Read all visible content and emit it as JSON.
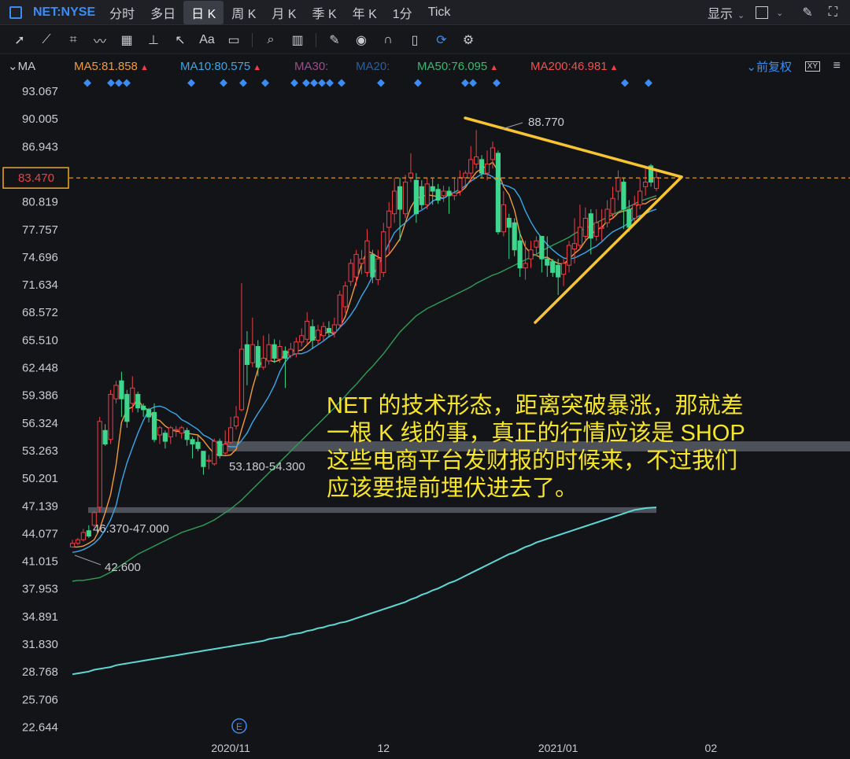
{
  "topbar": {
    "symbol": "NET:NYSE",
    "periods": [
      "分时",
      "多日",
      "日 K",
      "周 K",
      "月 K",
      "季 K",
      "年 K",
      "1分",
      "Tick"
    ],
    "active_period_index": 2,
    "show_label": "显示"
  },
  "toolbar": {
    "tools": [
      "cursor-icon",
      "trendline-icon",
      "polyline-icon",
      "wave-icon",
      "fibonacci-icon",
      "horizontal-line-icon",
      "arrow-icon",
      "text-icon",
      "note-icon",
      "zoom-icon",
      "measure-icon",
      "pen-icon",
      "eye-icon",
      "magnet-icon",
      "trash-icon",
      "sync-icon",
      "settings-icon"
    ],
    "text_tool_label": "Aa"
  },
  "indicators": {
    "label": "MA",
    "ma5": "MA5:81.858",
    "ma10": "MA10:80.575",
    "ma30": "MA30:",
    "ma20": "MA20:",
    "ma50": "MA50:76.095",
    "ma200": "MA200:46.981",
    "adjust_label": "前复权",
    "colors": {
      "ma5": "#f29a3c",
      "ma10": "#3aa7e8",
      "ma30": "#9a4f8d",
      "ma20": "#2d5f99",
      "ma50": "#3ab86e",
      "ma200": "#f05050"
    }
  },
  "chart_data": {
    "type": "candlestick",
    "symbol": "NET:NYSE",
    "y_ticks": [
      "93.067",
      "90.005",
      "86.943",
      "83.881",
      "80.819",
      "77.757",
      "74.696",
      "71.634",
      "68.572",
      "65.510",
      "62.448",
      "59.386",
      "56.324",
      "53.263",
      "50.201",
      "47.139",
      "44.077",
      "41.015",
      "37.953",
      "34.891",
      "31.830",
      "28.768",
      "25.706",
      "22.644"
    ],
    "ylim": [
      22.644,
      93.067
    ],
    "x_ticks": [
      "2020/11",
      "12",
      "2021/01",
      "02"
    ],
    "current_price": "83.470",
    "current_price_value": 83.47,
    "candles": [
      [
        42.6,
        43.0,
        42.6,
        43.4
      ],
      [
        43.0,
        43.4,
        42.8,
        43.6
      ],
      [
        43.4,
        44.2,
        43.2,
        44.6
      ],
      [
        44.4,
        43.8,
        43.6,
        45.0
      ],
      [
        45.0,
        46.4,
        44.8,
        46.6
      ],
      [
        47.0,
        56.5,
        46.4,
        57.0
      ],
      [
        55.5,
        54.0,
        53.8,
        56.2
      ],
      [
        54.5,
        59.5,
        54.0,
        60.0
      ],
      [
        59.0,
        60.5,
        58.5,
        61.0
      ],
      [
        61.0,
        59.0,
        57.0,
        62.0
      ],
      [
        59.5,
        56.5,
        55.8,
        60.0
      ],
      [
        58.5,
        60.2,
        57.5,
        61.5
      ],
      [
        59.5,
        58.0,
        57.5,
        59.8
      ],
      [
        58.2,
        57.8,
        57.0,
        58.5
      ],
      [
        57.8,
        57.0,
        56.4,
        58.0
      ],
      [
        57.5,
        54.5,
        54.2,
        58.5
      ],
      [
        55.0,
        55.8,
        54.0,
        56.0
      ],
      [
        55.2,
        54.3,
        53.5,
        55.5
      ],
      [
        54.8,
        55.8,
        54.0,
        56.0
      ],
      [
        55.6,
        55.6,
        54.8,
        56.0
      ],
      [
        55.2,
        55.8,
        54.6,
        56.0
      ],
      [
        55.5,
        54.5,
        53.8,
        55.8
      ],
      [
        54.5,
        54.0,
        52.4,
        54.8
      ],
      [
        54.2,
        53.5,
        53.2,
        55.0
      ],
      [
        53.2,
        51.5,
        50.6,
        53.2
      ],
      [
        52.2,
        52.2,
        51.2,
        52.8
      ],
      [
        51.8,
        54.3,
        51.6,
        54.6
      ],
      [
        54.3,
        52.7,
        52.4,
        54.6
      ],
      [
        53.0,
        54.0,
        52.8,
        55.5
      ],
      [
        54.2,
        55.8,
        54.0,
        57.0
      ],
      [
        56.0,
        57.0,
        55.6,
        58.2
      ],
      [
        57.8,
        64.5,
        57.6,
        71.8
      ],
      [
        65.0,
        62.8,
        60.5,
        66.5
      ],
      [
        63.0,
        65.0,
        62.5,
        68.0
      ],
      [
        64.8,
        62.5,
        61.5,
        65.5
      ],
      [
        62.5,
        63.5,
        62.2,
        66.0
      ],
      [
        63.2,
        65.0,
        62.8,
        66.2
      ],
      [
        65.0,
        63.5,
        63.0,
        65.6
      ],
      [
        63.4,
        64.8,
        63.0,
        65.5
      ],
      [
        64.3,
        63.5,
        60.2,
        64.8
      ],
      [
        63.8,
        64.5,
        63.5,
        65.2
      ],
      [
        64.0,
        65.3,
        63.6,
        65.8
      ],
      [
        65.3,
        66.0,
        64.8,
        66.8
      ],
      [
        65.6,
        67.6,
        65.0,
        68.6
      ],
      [
        67.0,
        65.5,
        64.5,
        67.8
      ],
      [
        65.5,
        66.6,
        65.0,
        67.2
      ],
      [
        66.0,
        67.0,
        65.4,
        67.5
      ],
      [
        66.8,
        66.4,
        65.8,
        67.6
      ],
      [
        66.4,
        67.2,
        65.8,
        68.0
      ],
      [
        67.2,
        70.5,
        66.8,
        71.0
      ],
      [
        69.2,
        71.5,
        68.5,
        72.0
      ],
      [
        72.0,
        74.0,
        71.5,
        74.5
      ],
      [
        72.5,
        75.0,
        71.5,
        75.5
      ],
      [
        74.0,
        74.5,
        72.8,
        75.5
      ],
      [
        73.0,
        76.5,
        72.5,
        77.8
      ],
      [
        75.0,
        72.5,
        71.8,
        75.5
      ],
      [
        72.2,
        74.5,
        71.6,
        75.5
      ],
      [
        73.0,
        77.5,
        72.5,
        78.5
      ],
      [
        78.0,
        79.8,
        75.0,
        80.8
      ],
      [
        79.5,
        82.0,
        78.5,
        83.5
      ],
      [
        82.5,
        80.0,
        76.5,
        83.5
      ],
      [
        79.5,
        83.0,
        79.0,
        83.8
      ],
      [
        83.5,
        84.0,
        83.0,
        86.2
      ],
      [
        83.2,
        79.5,
        78.5,
        84.0
      ],
      [
        82.5,
        80.5,
        80.0,
        83.2
      ],
      [
        80.5,
        82.8,
        80.0,
        83.5
      ],
      [
        82.5,
        82.0,
        80.5,
        83.4
      ],
      [
        82.2,
        81.0,
        80.6,
        82.8
      ],
      [
        81.5,
        82.0,
        80.8,
        82.6
      ],
      [
        82.0,
        81.5,
        79.5,
        82.5
      ],
      [
        81.5,
        81.8,
        81.0,
        83.5
      ],
      [
        82.0,
        83.5,
        81.5,
        84.3
      ],
      [
        83.5,
        84.0,
        82.5,
        84.3
      ],
      [
        84.0,
        85.5,
        83.0,
        87.0
      ],
      [
        85.0,
        85.8,
        84.5,
        88.77
      ],
      [
        85.5,
        84.0,
        83.5,
        86.0
      ],
      [
        84.0,
        85.0,
        83.2,
        86.5
      ],
      [
        85.5,
        86.8,
        84.5,
        87.5
      ],
      [
        86.2,
        77.5,
        77.2,
        86.5
      ],
      [
        77.5,
        80.5,
        77.0,
        82.0
      ],
      [
        79.0,
        78.0,
        74.5,
        79.5
      ],
      [
        78.5,
        75.5,
        74.8,
        79.0
      ],
      [
        76.5,
        73.5,
        72.5,
        77.5
      ],
      [
        73.5,
        74.0,
        72.2,
        76.5
      ],
      [
        74.5,
        75.5,
        73.5,
        76.5
      ],
      [
        75.8,
        76.5,
        74.8,
        77.0
      ],
      [
        77.0,
        74.5,
        73.0,
        77.0
      ],
      [
        74.5,
        73.8,
        72.5,
        77.0
      ],
      [
        74.2,
        73.0,
        72.5,
        74.5
      ],
      [
        73.8,
        72.5,
        70.5,
        74.5
      ],
      [
        72.8,
        74.0,
        71.5,
        74.5
      ],
      [
        73.8,
        76.0,
        73.0,
        76.5
      ],
      [
        75.6,
        76.2,
        74.0,
        79.0
      ],
      [
        76.0,
        78.0,
        75.5,
        80.5
      ],
      [
        77.0,
        79.0,
        76.5,
        80.2
      ],
      [
        79.5,
        76.8,
        75.0,
        80.0
      ],
      [
        77.0,
        78.5,
        76.5,
        80.0
      ],
      [
        78.0,
        78.0,
        76.5,
        80.0
      ],
      [
        78.5,
        80.0,
        78.0,
        81.0
      ],
      [
        79.5,
        81.2,
        79.0,
        82.5
      ],
      [
        82.0,
        83.5,
        81.0,
        84.3
      ],
      [
        83.0,
        80.0,
        77.8,
        83.5
      ],
      [
        80.0,
        78.0,
        77.5,
        81.0
      ],
      [
        79.0,
        80.5,
        78.5,
        81.5
      ],
      [
        80.5,
        82.0,
        80.0,
        83.5
      ],
      [
        82.5,
        83.0,
        81.5,
        84.5
      ],
      [
        84.8,
        83.0,
        82.5,
        85.0
      ],
      [
        82.3,
        83.5,
        82.0,
        84.2
      ]
    ],
    "series": [
      {
        "name": "MA5",
        "value_label": "81.858",
        "values": [
          42.6,
          42.6,
          42.7,
          43.0,
          43.4,
          44.6,
          46.4,
          48.4,
          51.7,
          56.4,
          57.8,
          58.1,
          59.0,
          58.0,
          57.8,
          56.8,
          56.6,
          56.0,
          55.6,
          55.4,
          55.4,
          55.2,
          55.1,
          55.0,
          54.4,
          53.6,
          52.9,
          52.8,
          52.7,
          52.8,
          53.4,
          55.6,
          57.6,
          60.2,
          62.3,
          63.5,
          63.3,
          63.1,
          63.3,
          63.9,
          64.4,
          64.3,
          64.4,
          65.0,
          65.6,
          66.0,
          66.2,
          66.4,
          66.2,
          66.9,
          68.1,
          70.0,
          72.0,
          73.9,
          75.4,
          75.1,
          74.7,
          74.5,
          75.0,
          75.8,
          76.7,
          78.5,
          80.2,
          81.2,
          81.4,
          81.6,
          81.5,
          81.4,
          81.2,
          81.6,
          81.7,
          81.9,
          82.4,
          83.3,
          84.1,
          84.5,
          84.8,
          85.2,
          84.2,
          82.5,
          81.6,
          79.9,
          77.3,
          75.8,
          75.1,
          74.9,
          74.6,
          74.7,
          74.3,
          74.0,
          73.9,
          74.5,
          75.1,
          75.6,
          76.5,
          77.2,
          77.7,
          78.0,
          78.7,
          79.0,
          79.6,
          79.8,
          79.9,
          80.3,
          80.6,
          80.6,
          81.0,
          81.2
        ]
      },
      {
        "name": "MA10",
        "value_label": "80.575",
        "values": [
          42.0,
          42.1,
          42.3,
          42.6,
          43.0,
          43.6,
          44.5,
          45.6,
          47.2,
          49.8,
          51.9,
          53.6,
          55.2,
          56.6,
          57.8,
          58.1,
          58.2,
          58.0,
          57.6,
          57.3,
          56.7,
          56.4,
          56.0,
          55.6,
          55.0,
          54.7,
          54.3,
          54.0,
          53.8,
          53.7,
          53.7,
          54.4,
          55.2,
          56.4,
          57.4,
          58.3,
          59.3,
          60.5,
          62.0,
          63.1,
          63.8,
          64.0,
          64.0,
          64.2,
          64.6,
          65.0,
          65.4,
          65.9,
          66.2,
          66.9,
          67.5,
          68.3,
          69.2,
          70.4,
          71.4,
          72.6,
          73.7,
          74.9,
          76.2,
          77.4,
          78.0,
          78.5,
          79.1,
          79.6,
          79.9,
          80.3,
          80.9,
          81.2,
          81.2,
          81.6,
          81.9,
          82.2,
          82.6,
          83.1,
          83.5,
          83.9,
          83.9,
          83.6,
          83.0,
          82.7,
          82.5,
          82.2,
          81.3,
          79.8,
          78.6,
          77.6,
          76.8,
          76.1,
          75.5,
          75.0,
          74.6,
          74.5,
          74.6,
          74.9,
          75.2,
          75.6,
          75.9,
          76.4,
          77.0,
          77.5,
          77.8,
          78.1,
          78.5,
          79.0,
          79.3,
          79.5,
          79.8,
          80.0
        ]
      },
      {
        "name": "MA50",
        "value_label": "76.095",
        "values": [
          38.8,
          38.9,
          38.9,
          39.0,
          39.1,
          39.2,
          39.5,
          39.8,
          40.2,
          40.6,
          41.0,
          41.4,
          41.8,
          42.1,
          42.4,
          42.7,
          43.0,
          43.3,
          43.6,
          43.9,
          44.2,
          44.4,
          44.6,
          44.8,
          45.0,
          45.3,
          45.6,
          46.0,
          46.4,
          46.8,
          47.3,
          47.8,
          48.4,
          49.0,
          49.6,
          50.2,
          50.8,
          51.4,
          52.0,
          52.6,
          53.2,
          53.8,
          54.4,
          55.0,
          55.6,
          56.2,
          56.8,
          57.4,
          58.0,
          58.7,
          59.3,
          60.0,
          60.6,
          61.3,
          62.0,
          62.6,
          63.3,
          64.0,
          64.8,
          65.6,
          66.4,
          67.0,
          67.6,
          68.2,
          68.6,
          69.0,
          69.3,
          69.6,
          69.9,
          70.2,
          70.5,
          70.8,
          71.1,
          71.4,
          71.8,
          72.1,
          72.4,
          72.7,
          72.9,
          73.2,
          73.5,
          73.8,
          74.1,
          74.4,
          74.7,
          75.0,
          75.4,
          75.7,
          76.0,
          76.3,
          76.6,
          76.9,
          77.3,
          77.6,
          77.9,
          78.2,
          78.5,
          78.8,
          79.1,
          79.4,
          79.7,
          80.0,
          80.3,
          80.6,
          80.9,
          81.1,
          81.3,
          81.5
        ]
      },
      {
        "name": "MA200",
        "value_label": "46.981",
        "values": [
          28.5,
          28.6,
          28.7,
          28.8,
          29.0,
          29.1,
          29.2,
          29.3,
          29.5,
          29.6,
          29.7,
          29.8,
          29.9,
          30.0,
          30.1,
          30.2,
          30.3,
          30.4,
          30.5,
          30.6,
          30.7,
          30.8,
          30.9,
          31.0,
          31.1,
          31.2,
          31.3,
          31.4,
          31.5,
          31.6,
          31.7,
          31.8,
          31.9,
          32.0,
          32.1,
          32.2,
          32.4,
          32.5,
          32.6,
          32.7,
          32.9,
          33.0,
          33.1,
          33.3,
          33.4,
          33.6,
          33.7,
          33.9,
          34.0,
          34.2,
          34.3,
          34.5,
          34.7,
          34.9,
          35.1,
          35.3,
          35.5,
          35.7,
          35.9,
          36.1,
          36.3,
          36.5,
          36.8,
          37.0,
          37.3,
          37.5,
          37.8,
          38.0,
          38.3,
          38.6,
          38.8,
          39.1,
          39.4,
          39.7,
          40.0,
          40.3,
          40.6,
          40.9,
          41.2,
          41.5,
          41.8,
          42.0,
          42.3,
          42.6,
          42.8,
          43.1,
          43.3,
          43.5,
          43.7,
          43.9,
          44.1,
          44.3,
          44.5,
          44.7,
          44.9,
          45.1,
          45.3,
          45.5,
          45.7,
          45.9,
          46.1,
          46.3,
          46.5,
          46.7,
          46.8,
          46.9,
          46.95,
          46.981
        ]
      }
    ],
    "annotations": {
      "high_label": "88.770",
      "low_label": "42.600",
      "zone1_label": "53.180-54.300",
      "zone2_label": "46.370-47.000",
      "earnings_marker": "E",
      "comment": "NET 的技术形态，距离突破暴涨，那就差一根 K 线的事，真正的行情应该是 SHOP 这些电商平台发财报的时候来，不过我们应该要提前埋伏进去了。",
      "comment_lines": [
        "NET 的技术形态，距离突破暴涨，那就差",
        "一根 K 线的事，真正的行情应该是 SHOP",
        "这些电商平台发财报的时候来，不过我们",
        "应该要提前埋伏进去了。"
      ]
    },
    "colors": {
      "up": "#f03e46",
      "down": "#3dd68c",
      "background": "#131418",
      "triangle": "#f7c531",
      "price_line": "#f5a623",
      "signal": "#3b8cf3",
      "comment": "#f7e52a"
    }
  }
}
